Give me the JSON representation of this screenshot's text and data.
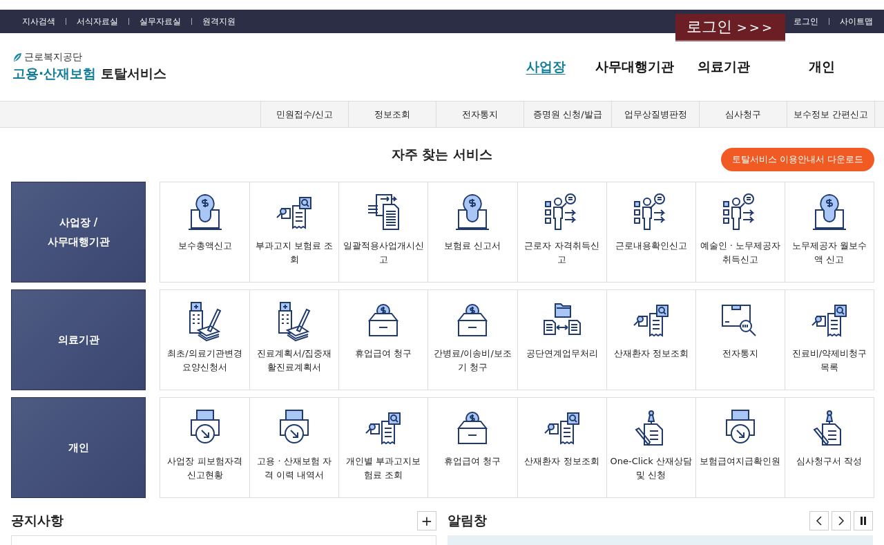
{
  "utility_links": [
    "지사검색",
    "서식자료실",
    "실무자료실",
    "원격지원"
  ],
  "login_banner": {
    "label": "로그인",
    "arrows": ">>>"
  },
  "account_links": [
    "로그인",
    "사이트맵"
  ],
  "logo": {
    "org": "근로복지공단",
    "title_highlight": "고용·산재보험",
    "title_rest": "토탈서비스"
  },
  "main_nav": [
    {
      "label": "사업장",
      "selected": true
    },
    {
      "label": "사무대행기관",
      "selected": false
    },
    {
      "label": "의료기관",
      "selected": false
    },
    {
      "label": "개인",
      "selected": false
    }
  ],
  "sub_nav": [
    "민원접수/신고",
    "정보조회",
    "전자통지",
    "증명원 신청/발급",
    "업무상질병판정",
    "심사청구",
    "보수정보 간편신고"
  ],
  "section_title": "자주 찾는 서비스",
  "download_button": "토탈서비스 이용안내서 다운로드",
  "groups": [
    {
      "label": "사업장 /\n사무대행기관",
      "services": [
        {
          "kind": "bulb",
          "label": "보수총액신고"
        },
        {
          "kind": "receipt",
          "label": "부과고지 보험료 조회"
        },
        {
          "kind": "transfer",
          "label": "일괄적용사업개시신고"
        },
        {
          "kind": "bulb",
          "label": "보험료 신고서"
        },
        {
          "kind": "presenter",
          "label": "근로자 자격취득신고"
        },
        {
          "kind": "presenter",
          "label": "근로내용확인신고"
        },
        {
          "kind": "presenter",
          "label": "예술인 · 노무제공자 취득신고"
        },
        {
          "kind": "bulb",
          "label": "노무제공자 월보수액 신고"
        }
      ]
    },
    {
      "label": "의료기관",
      "services": [
        {
          "kind": "hospital",
          "label": "최초/의료기관변경 요양신청서"
        },
        {
          "kind": "hospital",
          "label": "진료계획서/집중재활진료계획서"
        },
        {
          "kind": "moneybox",
          "label": "휴업급여 청구"
        },
        {
          "kind": "moneybox",
          "label": "간병료/이송비/보조기 청구"
        },
        {
          "kind": "folders",
          "label": "공단연계업무처리"
        },
        {
          "kind": "receipt",
          "label": "산재환자 정보조회"
        },
        {
          "kind": "parcel",
          "label": "전자통지"
        },
        {
          "kind": "receipt",
          "label": "진료비/약제비청구목록"
        }
      ]
    },
    {
      "label": "개인",
      "services": [
        {
          "kind": "printer",
          "label": "사업장 피보험자격 신고현황"
        },
        {
          "kind": "printer",
          "label": "고용 · 산재보험 자격 이력 내역서"
        },
        {
          "kind": "receipt",
          "label": "개인별 부과고지보험료 조회"
        },
        {
          "kind": "moneybox",
          "label": "휴업급여 청구"
        },
        {
          "kind": "receipt",
          "label": "산재환자 정보조회"
        },
        {
          "kind": "pin",
          "label": "One-Click 산재상담 및 신청"
        },
        {
          "kind": "printer",
          "label": "보험급여지급확인원"
        },
        {
          "kind": "pin",
          "label": "심사청구서 작성"
        }
      ]
    }
  ],
  "notice": {
    "title": "공지사항",
    "more": "+"
  },
  "alert": {
    "title": "알림창"
  }
}
